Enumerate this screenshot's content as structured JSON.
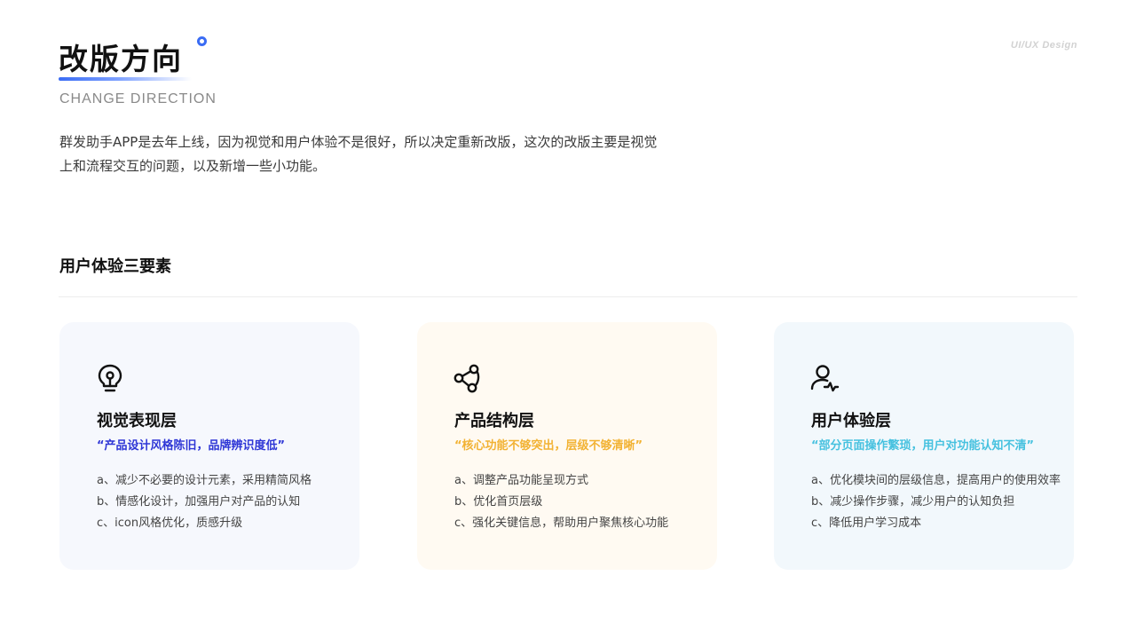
{
  "header": {
    "title": "改版方向",
    "subtitle": "CHANGE DIRECTION",
    "brand": "UI/UX Design"
  },
  "intro": {
    "line1": "群发助手APP是去年上线，因为视觉和用户体验不是很好，所以决定重新改版，这次的改版主要是视觉",
    "line2": "上和流程交互的问题，以及新增一些小功能。"
  },
  "section": {
    "title": "用户体验三要素"
  },
  "cards": [
    {
      "icon": "lightbulb-icon",
      "title": "视觉表现层",
      "quote": "“产品设计风格陈旧，品牌辨识度低”",
      "accent": "#2e36d6",
      "items": [
        "a、减少不必要的设计元素，采用精简风格",
        "b、情感化设计，加强用户对产品的认知",
        "c、icon风格优化，质感升级"
      ]
    },
    {
      "icon": "network-nodes-icon",
      "title": "产品结构层",
      "quote": "“核心功能不够突出，层级不够清晰”",
      "accent": "#f2b233",
      "items": [
        "a、调整产品功能呈现方式",
        "b、优化首页层级",
        "c、强化关键信息，帮助用户聚焦核心功能"
      ]
    },
    {
      "icon": "user-icon",
      "title": "用户体验层",
      "quote": "“部分页面操作繁琐，用户对功能认知不清”",
      "accent": "#46c1df",
      "items": [
        "a、优化模块间的层级信息，提高用户的使用效率",
        "b、减少操作步骤，减少用户的认知负担",
        "c、降低用户学习成本"
      ]
    }
  ]
}
